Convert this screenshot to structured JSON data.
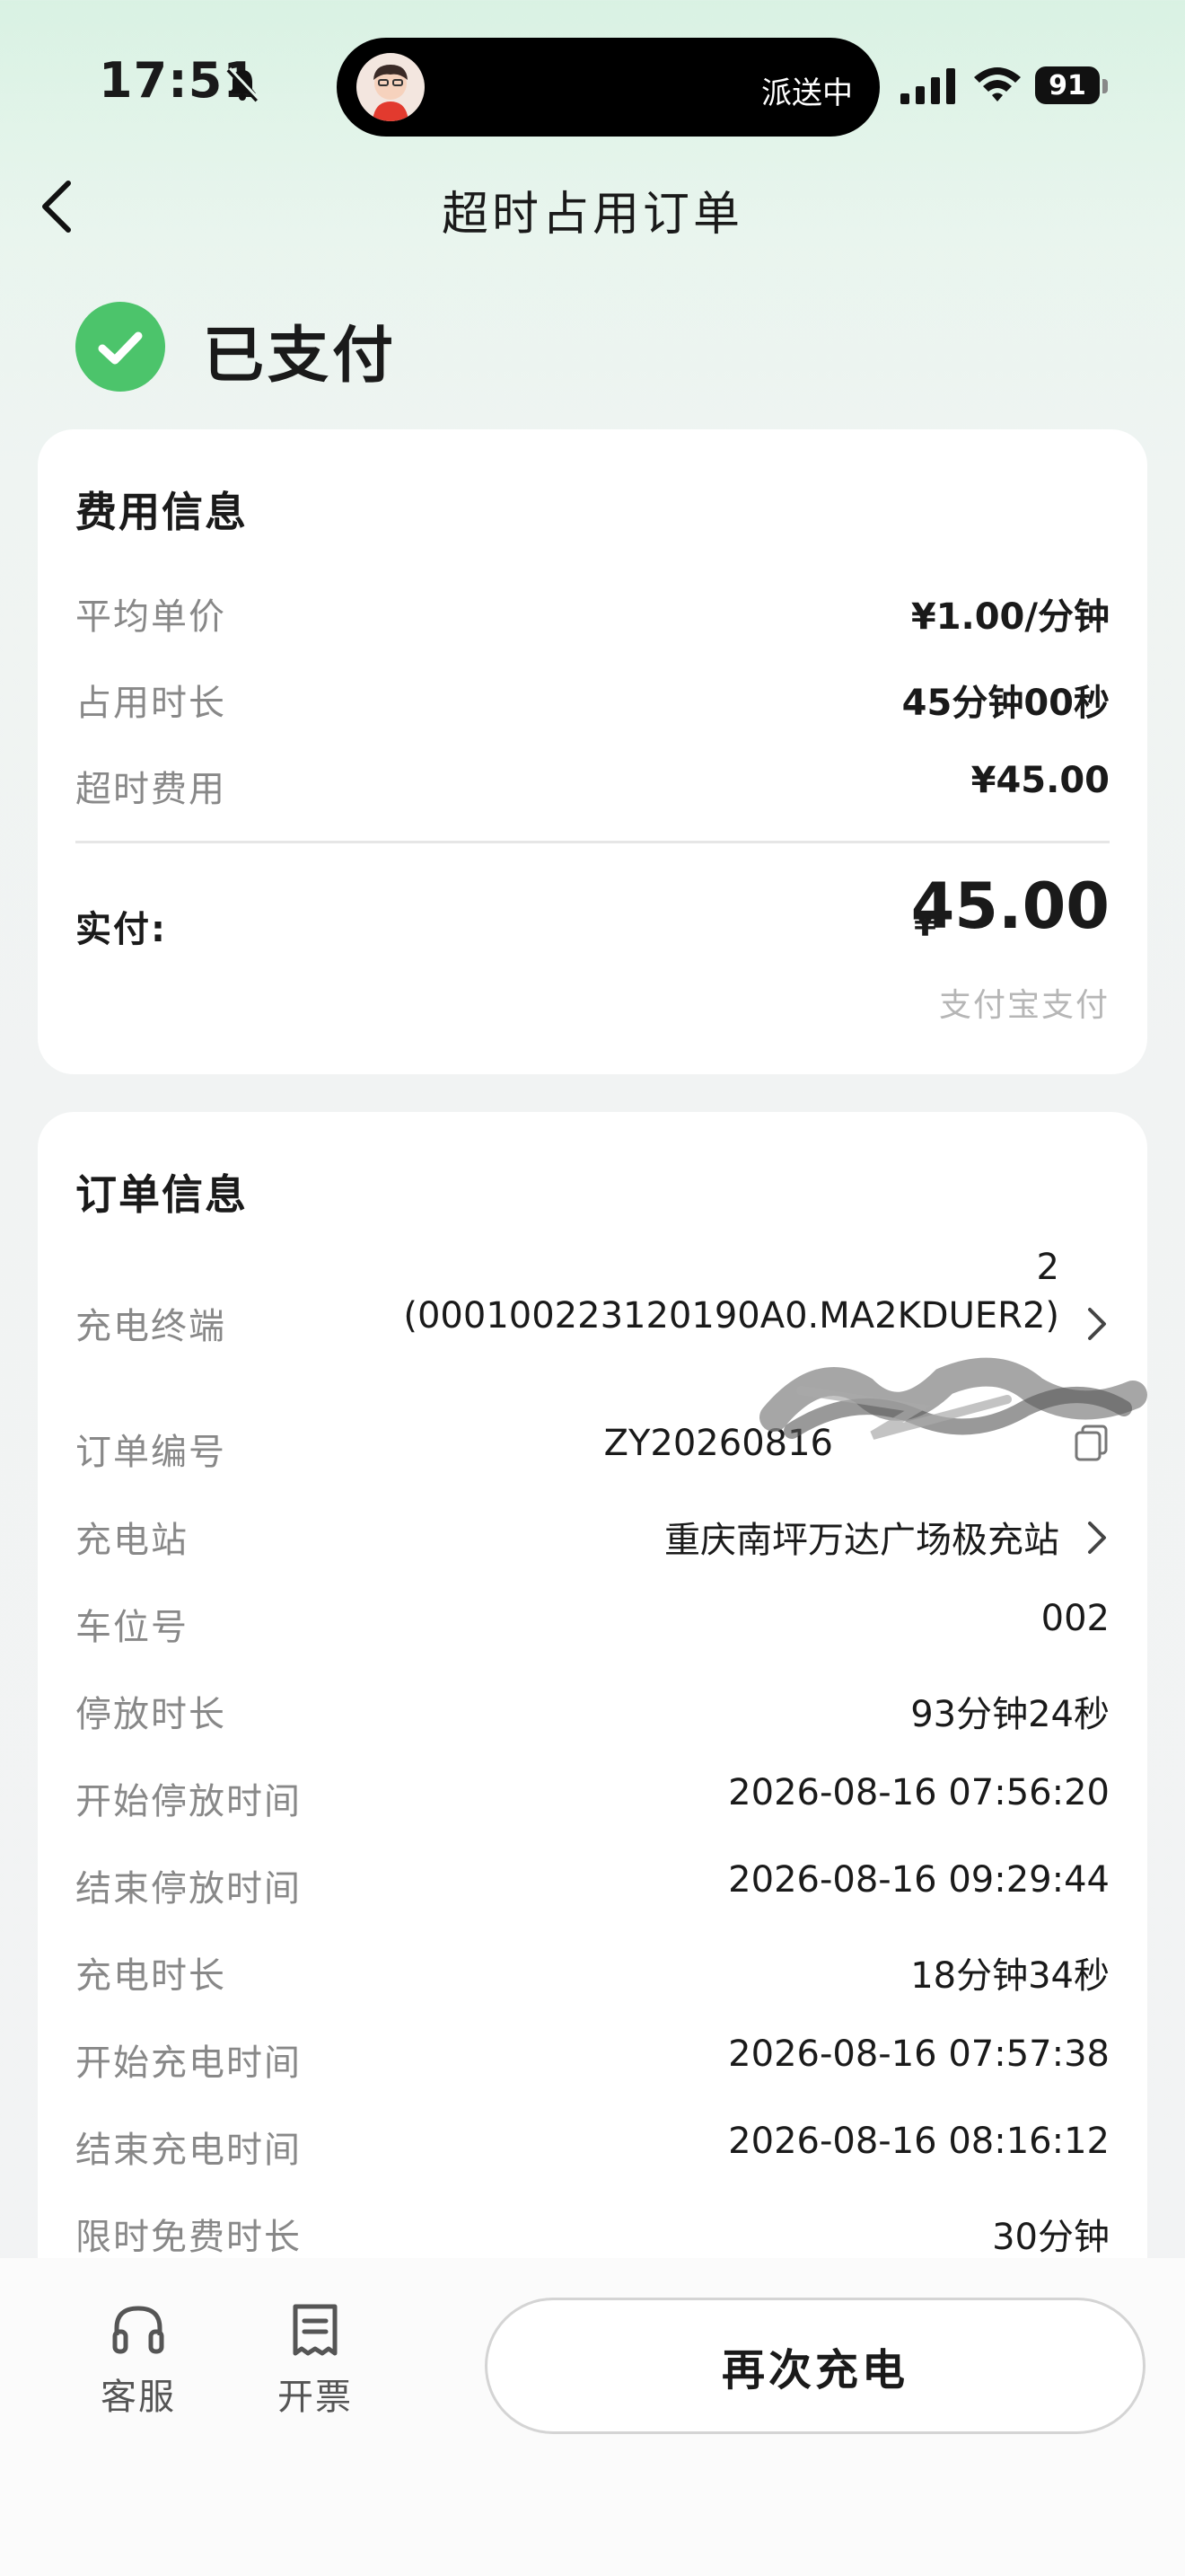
{
  "status_bar": {
    "time": "17:51",
    "island_text": "派送中",
    "battery": "91"
  },
  "header": {
    "title": "超时占用订单"
  },
  "order_status": {
    "text": "已支付",
    "color": "#4cc46b"
  },
  "fee_info": {
    "title": "费用信息",
    "rows": [
      {
        "label": "平均单价",
        "value": "¥1.00/分钟"
      },
      {
        "label": "占用时长",
        "value": "45分钟00秒"
      },
      {
        "label": "超时费用",
        "value": "¥45.00"
      }
    ],
    "paid_label": "实付:",
    "currency": "¥",
    "amount": "45.00",
    "pay_method": "支付宝支付"
  },
  "order_info": {
    "title": "订单信息",
    "terminal": {
      "label": "充电终端",
      "line1": "2",
      "line2": "(000100223120190A0.MA2KDUER2)"
    },
    "order_no": {
      "label": "订单编号",
      "value": "ZY20260816"
    },
    "station": {
      "label": "充电站",
      "value": "重庆南坪万达广场极充站"
    },
    "rows": [
      {
        "label": "车位号",
        "value": "002"
      },
      {
        "label": "停放时长",
        "value": "93分钟24秒"
      },
      {
        "label": "开始停放时间",
        "value": "2026-08-16 07:56:20"
      },
      {
        "label": "结束停放时间",
        "value": "2026-08-16 09:29:44"
      },
      {
        "label": "充电时长",
        "value": "18分钟34秒"
      },
      {
        "label": "开始充电时间",
        "value": "2026-08-16 07:57:38"
      },
      {
        "label": "结束充电时间",
        "value": "2026-08-16 08:16:12"
      },
      {
        "label": "限时免费时长",
        "value": "30分钟"
      }
    ]
  },
  "bottom_bar": {
    "service_label": "客服",
    "service_icon": "headset-icon",
    "invoice_label": "开票",
    "invoice_icon": "receipt-icon",
    "recharge_label": "再次充电"
  }
}
